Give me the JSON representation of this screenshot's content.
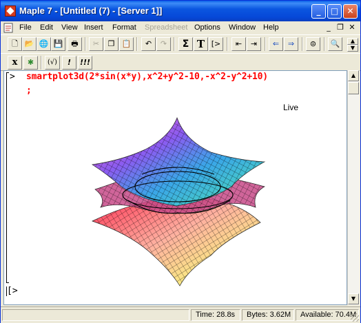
{
  "window": {
    "title": "Maple 7  - [Untitled (7) - [Server 1]]",
    "controls": {
      "minimize": "_",
      "maximize": "□",
      "close": "✕"
    }
  },
  "menubar": {
    "items": [
      "File",
      "Edit",
      "View",
      "Insert",
      "Format",
      "Spreadsheet",
      "Options",
      "Window",
      "Help"
    ],
    "disabled": [
      "Spreadsheet"
    ],
    "mdi": {
      "minimize": "_",
      "restore": "❐",
      "close": "✕"
    }
  },
  "toolbar1": {
    "buttons": [
      {
        "name": "new-doc-icon",
        "glyph": "🗋"
      },
      {
        "name": "open-folder-icon",
        "glyph": "📂"
      },
      {
        "name": "open-url-icon",
        "glyph": "🌐"
      },
      {
        "name": "save-icon",
        "glyph": "💾"
      },
      {
        "name": "print-icon",
        "glyph": "🖶"
      },
      {
        "name": "cut-icon",
        "glyph": "✂"
      },
      {
        "name": "copy-icon",
        "glyph": "❐"
      },
      {
        "name": "paste-icon",
        "glyph": "📋"
      },
      {
        "name": "undo-icon",
        "glyph": "↶"
      },
      {
        "name": "redo-icon",
        "glyph": "↷"
      },
      {
        "name": "sigma-icon",
        "glyph": "Σ"
      },
      {
        "name": "text-mode-icon",
        "glyph": "T"
      },
      {
        "name": "insert-input-icon",
        "glyph": "[>"
      },
      {
        "name": "outdent-icon",
        "glyph": "⇤"
      },
      {
        "name": "indent-icon",
        "glyph": "⇥"
      },
      {
        "name": "back-arrow-icon",
        "glyph": "⇐"
      },
      {
        "name": "forward-arrow-icon",
        "glyph": "⇒"
      },
      {
        "name": "stop-icon",
        "glyph": "⊜"
      },
      {
        "name": "zoom-icon",
        "glyph": "🔍"
      }
    ]
  },
  "toolbar2": {
    "buttons": [
      {
        "name": "text-input-icon",
        "glyph": "x"
      },
      {
        "name": "maple-leaf-icon",
        "glyph": "✱"
      },
      {
        "name": "parentheses-icon",
        "glyph": "(√)"
      },
      {
        "name": "execute-icon",
        "glyph": "!"
      },
      {
        "name": "execute-all-icon",
        "glyph": "!!!"
      }
    ]
  },
  "worksheet": {
    "prompt": ">",
    "input_line1": "smartplot3d(2*sin(x*y),x^2+y^2-10,-x^2-y^2+10)",
    "input_line2": ";",
    "plot_label": "Live",
    "empty_prompt": "[>"
  },
  "statusbar": {
    "time": "Time:  28.8s",
    "bytes": "Bytes: 3.62M",
    "available": "Available: 70.4M"
  },
  "colors": {
    "title_blue": "#0a5fe8",
    "input_red": "#ff0000",
    "face": "#ece9d8"
  }
}
